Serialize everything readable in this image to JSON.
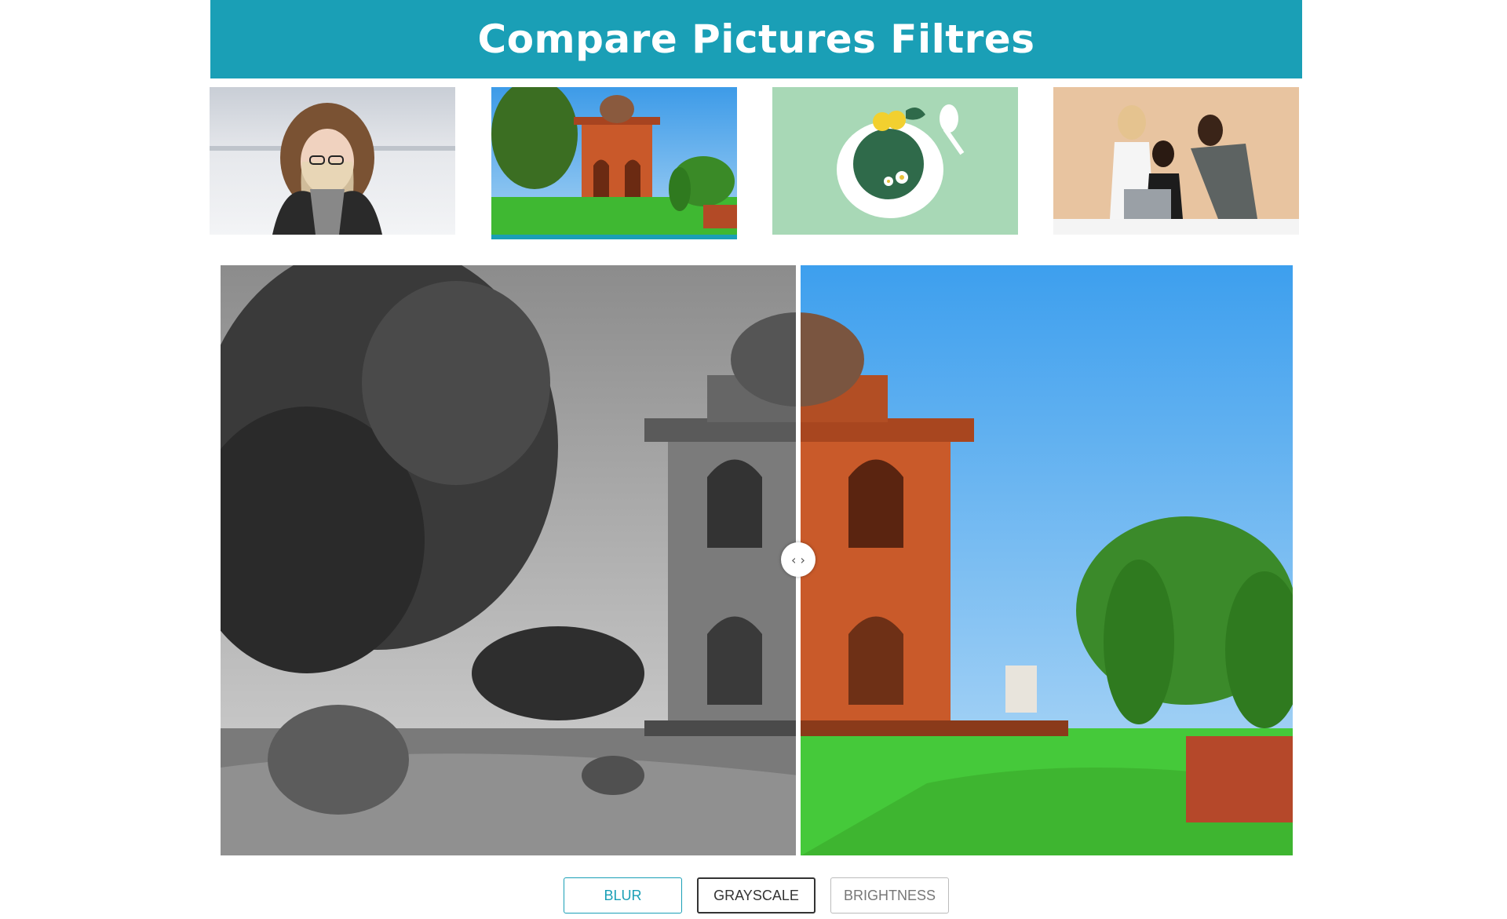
{
  "header": {
    "title": "Compare Pictures Filtres"
  },
  "colors": {
    "accent": "#1a9fb6",
    "header_text": "#ffffff"
  },
  "thumbnails": [
    {
      "name": "woman-in-snow",
      "active": false
    },
    {
      "name": "monument",
      "active": true
    },
    {
      "name": "tea-cup",
      "active": false
    },
    {
      "name": "team-at-laptop",
      "active": false
    }
  ],
  "compare": {
    "handle_icon": "arrows-left-right-icon",
    "handle_glyph": "‹ ›"
  },
  "filters": {
    "blur_label": "BLUR",
    "grayscale_label": "GRAYSCALE",
    "brightness_label": "BRIGHTNESS",
    "selected": "GRAYSCALE"
  }
}
